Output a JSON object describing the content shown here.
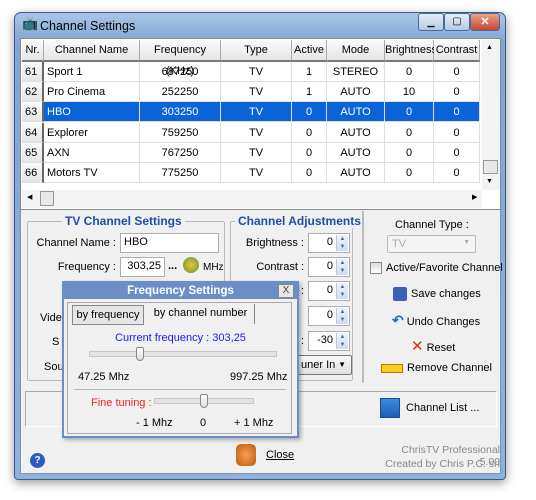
{
  "window": {
    "title": "Channel Settings"
  },
  "grid": {
    "columns": [
      "Nr.",
      "Channel Name",
      "Frequency (KHz)",
      "Type",
      "Active",
      "Mode",
      "Brightness",
      "Contrast"
    ],
    "rows": [
      [
        "61",
        "Sport 1",
        "687250",
        "TV",
        "1",
        "STEREO",
        "0",
        "0"
      ],
      [
        "62",
        "Pro Cinema",
        "252250",
        "TV",
        "1",
        "AUTO",
        "10",
        "0"
      ],
      [
        "63",
        "HBO",
        "303250",
        "TV",
        "0",
        "AUTO",
        "0",
        "0"
      ],
      [
        "64",
        "Explorer",
        "759250",
        "TV",
        "0",
        "AUTO",
        "0",
        "0"
      ],
      [
        "65",
        "AXN",
        "767250",
        "TV",
        "0",
        "AUTO",
        "0",
        "0"
      ],
      [
        "66",
        "Motors TV",
        "775250",
        "TV",
        "0",
        "AUTO",
        "0",
        "0"
      ]
    ],
    "selected_row": 2
  },
  "tv_settings": {
    "title": "TV Channel Settings",
    "name_label": "Channel Name :",
    "name_value": "HBO",
    "freq_label": "Frequency :",
    "freq_value": "303,25",
    "freq_more": "...",
    "freq_unit": "MHz",
    "video_label": "Vide",
    "s_label": "S",
    "sound_label": "Sou"
  },
  "adjustments": {
    "title": "Channel Adjustments",
    "brightness_label": "Brightness :",
    "brightness": "0",
    "contrast_label": "Contrast :",
    "contrast": "0",
    "hidden1_label": ":",
    "hidden1": "0",
    "hidden2": "0",
    "hidden3_label": ":",
    "hidden3": "-30",
    "source": "uner In"
  },
  "right": {
    "type_label": "Channel Type :",
    "type_value": "TV",
    "active_label": "Active/Favorite Channel",
    "active_checked": false,
    "save": "Save changes",
    "undo": "Undo Changes",
    "reset": "Reset",
    "remove": "Remove Channel"
  },
  "bottom": {
    "channel_list": "Channel List ...",
    "close": "Close",
    "product": "ChrisTV Professional 5.00",
    "credit": "Created by Chris P.C. srl"
  },
  "popup": {
    "title": "Frequency Settings",
    "close": "X",
    "tabs": [
      "by frequency",
      "by channel number"
    ],
    "active_tab": 0,
    "current_label": "Current frequency :",
    "current_value": "303,25",
    "min": "47.25 Mhz",
    "max": "997.25 Mhz",
    "freq_position": 0.27,
    "fine_label": "Fine tuning :",
    "fine_min": "- 1 Mhz",
    "fine_mid": "0",
    "fine_max": "+ 1 Mhz",
    "fine_position": 0.5
  },
  "colors": {
    "selection": "#0a64d8",
    "group_title": "#1e4fa3",
    "popup_title": "#6a8fc6",
    "current_freq": "#1a1aff",
    "fine_tuning": "#ff2020"
  }
}
